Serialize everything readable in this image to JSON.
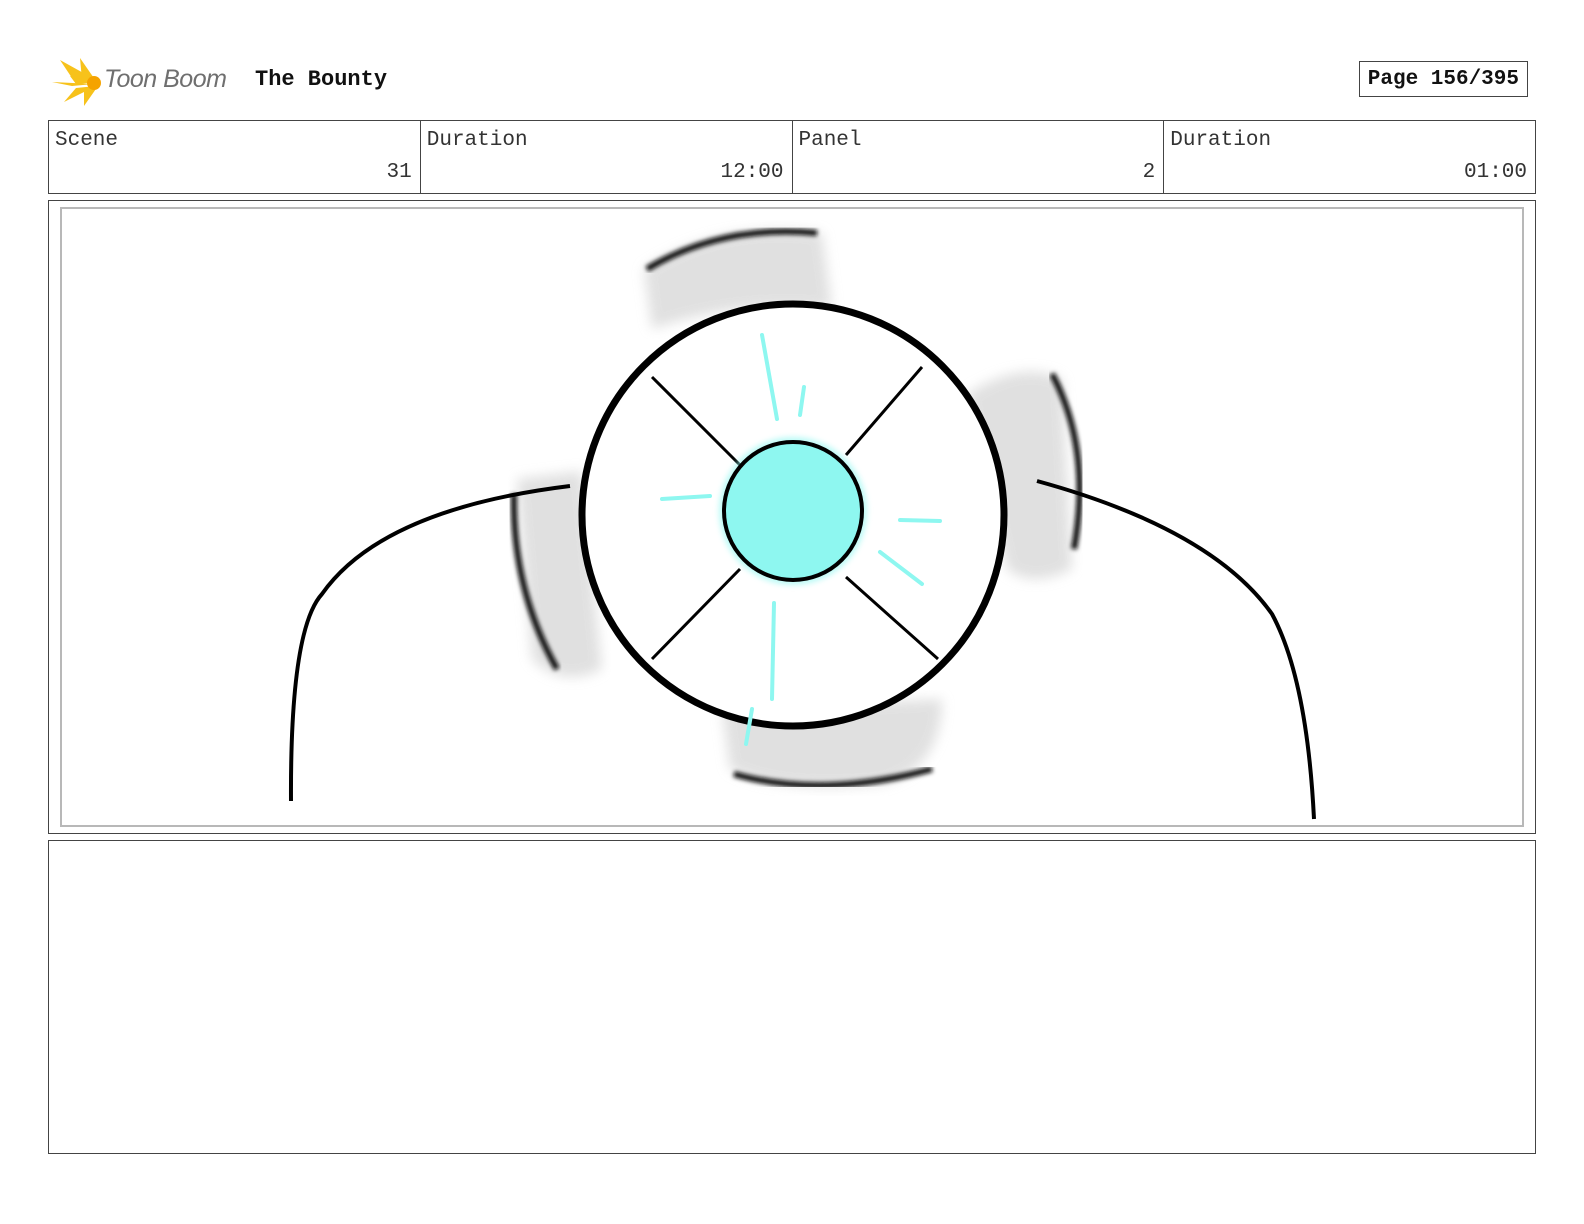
{
  "header": {
    "logo_text": "Toon Boom",
    "project_title": "The Bounty",
    "page_label": "Page 156/395"
  },
  "info": [
    {
      "label": "Scene",
      "value": "31"
    },
    {
      "label": "Duration",
      "value": "12:00"
    },
    {
      "label": "Panel",
      "value": "2"
    },
    {
      "label": "Duration",
      "value": "01:00"
    }
  ],
  "colors": {
    "core_glow": "#8ef7f0",
    "logo_yellow": "#f7c21b"
  },
  "notes": ""
}
